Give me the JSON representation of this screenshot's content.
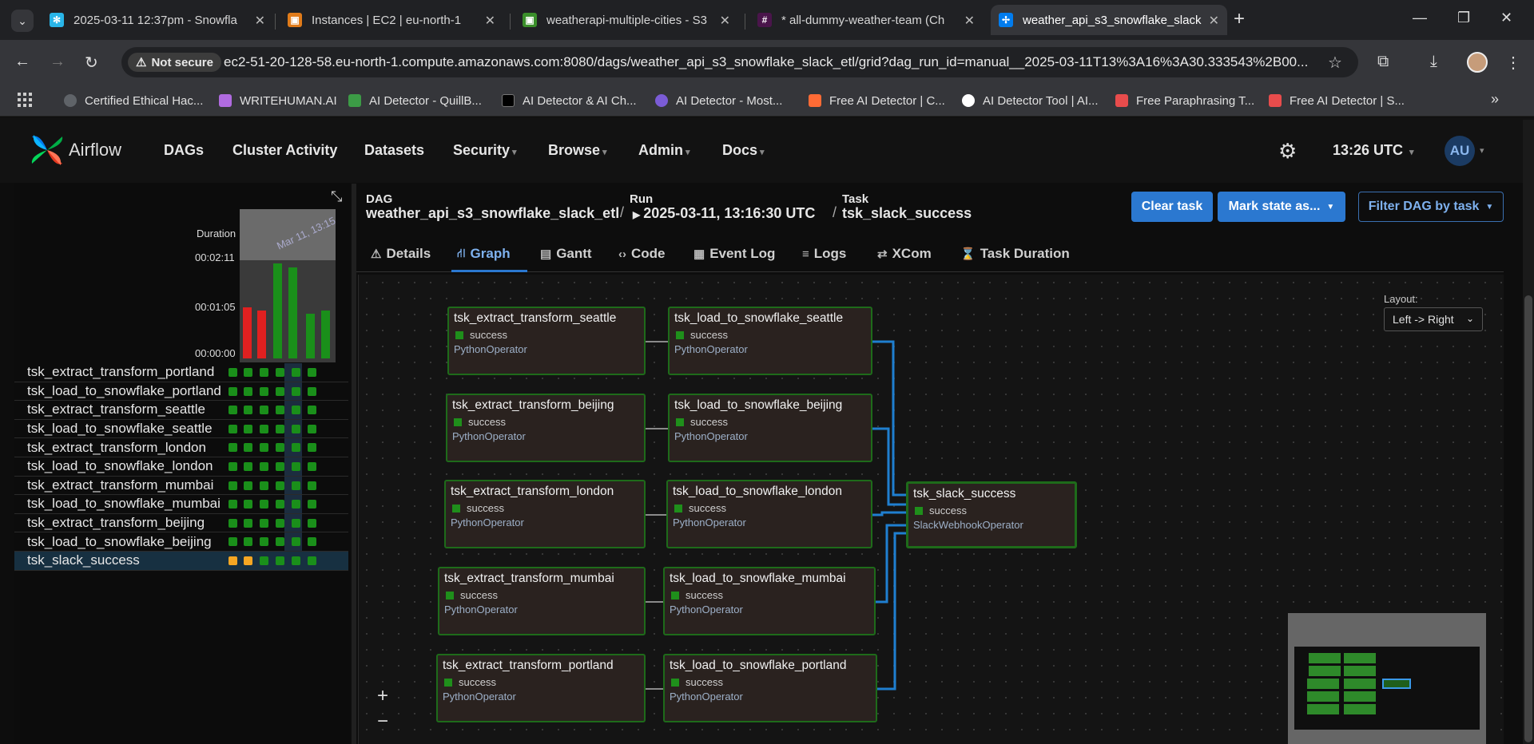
{
  "browser": {
    "tabs": [
      {
        "title": "2025-03-11 12:37pm - Snowfla",
        "fav_color": "#29b5e8",
        "fav_glyph": "✻"
      },
      {
        "title": "Instances | EC2 | eu-north-1",
        "fav_color": "#e07b1a",
        "fav_glyph": "▣"
      },
      {
        "title": "weatherapi-multiple-cities - S3",
        "fav_color": "#3b8f2b",
        "fav_glyph": "▣"
      },
      {
        "title": "* all-dummy-weather-team (Ch",
        "fav_color": "#4a154b",
        "fav_glyph": "#"
      },
      {
        "title": "weather_api_s3_snowflake_slack",
        "fav_color": "#017cee",
        "fav_glyph": "✢"
      }
    ],
    "not_secure_label": "Not secure",
    "url": "ec2-51-20-128-58.eu-north-1.compute.amazonaws.com:8080/dags/weather_api_s3_snowflake_slack_etl/grid?dag_run_id=manual__2025-03-11T13%3A16%3A30.333543%2B00...",
    "bookmarks": [
      {
        "label": "Certified Ethical Hac...",
        "color": "#5f6368"
      },
      {
        "label": "WRITEHUMAN.AI",
        "color": "#b06be0"
      },
      {
        "label": "AI Detector - QuillB...",
        "color": "#3c9b46"
      },
      {
        "label": "AI Detector & AI Ch...",
        "color": "#111111"
      },
      {
        "label": "AI Detector - Most...",
        "color": "#7b5cd6"
      },
      {
        "label": "Free AI Detector | C...",
        "color": "#ff6b35"
      },
      {
        "label": "AI Detector Tool | AI...",
        "color": "#ffffff"
      },
      {
        "label": "Free Paraphrasing T...",
        "color": "#e84c4c"
      },
      {
        "label": "Free AI Detector | S...",
        "color": "#e84c4c"
      }
    ]
  },
  "airflow": {
    "brand": "Airflow",
    "nav": [
      "DAGs",
      "Cluster Activity",
      "Datasets",
      "Security",
      "Browse",
      "Admin",
      "Docs"
    ],
    "nav_dropdown": [
      false,
      false,
      false,
      true,
      true,
      true,
      true
    ],
    "time": "13:26 UTC",
    "user_initials": "AU"
  },
  "grid": {
    "duration_label": "Duration",
    "ticks": [
      "00:02:11",
      "00:01:05",
      "00:00:00"
    ],
    "hover_date": "Mar 11, 13:15",
    "run_durations": [
      {
        "seconds": 70,
        "state": "failed"
      },
      {
        "seconds": 66,
        "state": "failed"
      },
      {
        "seconds": 130,
        "state": "success"
      },
      {
        "seconds": 124,
        "state": "success"
      },
      {
        "seconds": 61,
        "state": "success"
      },
      {
        "seconds": 66,
        "state": "success"
      }
    ],
    "tasks": [
      {
        "name": "tsk_extract_transform_portland",
        "states": [
          "s",
          "s",
          "s",
          "s",
          "s",
          "s"
        ]
      },
      {
        "name": "tsk_load_to_snowflake_portland",
        "states": [
          "s",
          "s",
          "s",
          "s",
          "s",
          "s"
        ]
      },
      {
        "name": "tsk_extract_transform_seattle",
        "states": [
          "s",
          "s",
          "s",
          "s",
          "s",
          "s"
        ]
      },
      {
        "name": "tsk_load_to_snowflake_seattle",
        "states": [
          "s",
          "s",
          "s",
          "s",
          "s",
          "s"
        ]
      },
      {
        "name": "tsk_extract_transform_london",
        "states": [
          "s",
          "s",
          "s",
          "s",
          "s",
          "s"
        ]
      },
      {
        "name": "tsk_load_to_snowflake_london",
        "states": [
          "s",
          "s",
          "s",
          "s",
          "s",
          "s"
        ]
      },
      {
        "name": "tsk_extract_transform_mumbai",
        "states": [
          "s",
          "s",
          "s",
          "s",
          "s",
          "s"
        ]
      },
      {
        "name": "tsk_load_to_snowflake_mumbai",
        "states": [
          "s",
          "s",
          "s",
          "s",
          "s",
          "s"
        ]
      },
      {
        "name": "tsk_extract_transform_beijing",
        "states": [
          "s",
          "s",
          "s",
          "s",
          "s",
          "s"
        ]
      },
      {
        "name": "tsk_load_to_snowflake_beijing",
        "states": [
          "s",
          "s",
          "s",
          "s",
          "s",
          "s"
        ]
      },
      {
        "name": "tsk_slack_success",
        "states": [
          "u",
          "u",
          "s",
          "s",
          "s",
          "s"
        ]
      }
    ],
    "state_colors": {
      "s": "#1a8f1a",
      "u": "#f5a623",
      "failed": "#e02020",
      "success": "#1a8f1a"
    }
  },
  "header": {
    "dag_label": "DAG",
    "dag_id": "weather_api_s3_snowflake_slack_etl",
    "run_label": "Run",
    "run_value": "2025-03-11, 13:16:30 UTC",
    "task_label": "Task",
    "task_value": "tsk_slack_success",
    "clear_task": "Clear task",
    "mark_state": "Mark state as...",
    "filter_dag": "Filter DAG by task"
  },
  "tabs": [
    "Details",
    "Graph",
    "Gantt",
    "Code",
    "Event Log",
    "Logs",
    "XCom",
    "Task Duration"
  ],
  "graph": {
    "layout_label": "Layout:",
    "layout_value": "Left -> Right",
    "nodes": [
      {
        "title": "tsk_extract_transform_seattle",
        "status": "success",
        "operator": "PythonOperator"
      },
      {
        "title": "tsk_load_to_snowflake_seattle",
        "status": "success",
        "operator": "PythonOperator"
      },
      {
        "title": "tsk_extract_transform_beijing",
        "status": "success",
        "operator": "PythonOperator"
      },
      {
        "title": "tsk_load_to_snowflake_beijing",
        "status": "success",
        "operator": "PythonOperator"
      },
      {
        "title": "tsk_extract_transform_london",
        "status": "success",
        "operator": "PythonOperator"
      },
      {
        "title": "tsk_load_to_snowflake_london",
        "status": "success",
        "operator": "PythonOperator"
      },
      {
        "title": "tsk_extract_transform_mumbai",
        "status": "success",
        "operator": "PythonOperator"
      },
      {
        "title": "tsk_load_to_snowflake_mumbai",
        "status": "success",
        "operator": "PythonOperator"
      },
      {
        "title": "tsk_extract_transform_portland",
        "status": "success",
        "operator": "PythonOperator"
      },
      {
        "title": "tsk_load_to_snowflake_portland",
        "status": "success",
        "operator": "PythonOperator"
      },
      {
        "title": "tsk_slack_success",
        "status": "success",
        "operator": "SlackWebhookOperator"
      }
    ],
    "zoom_in": "+",
    "zoom_out": "−"
  }
}
